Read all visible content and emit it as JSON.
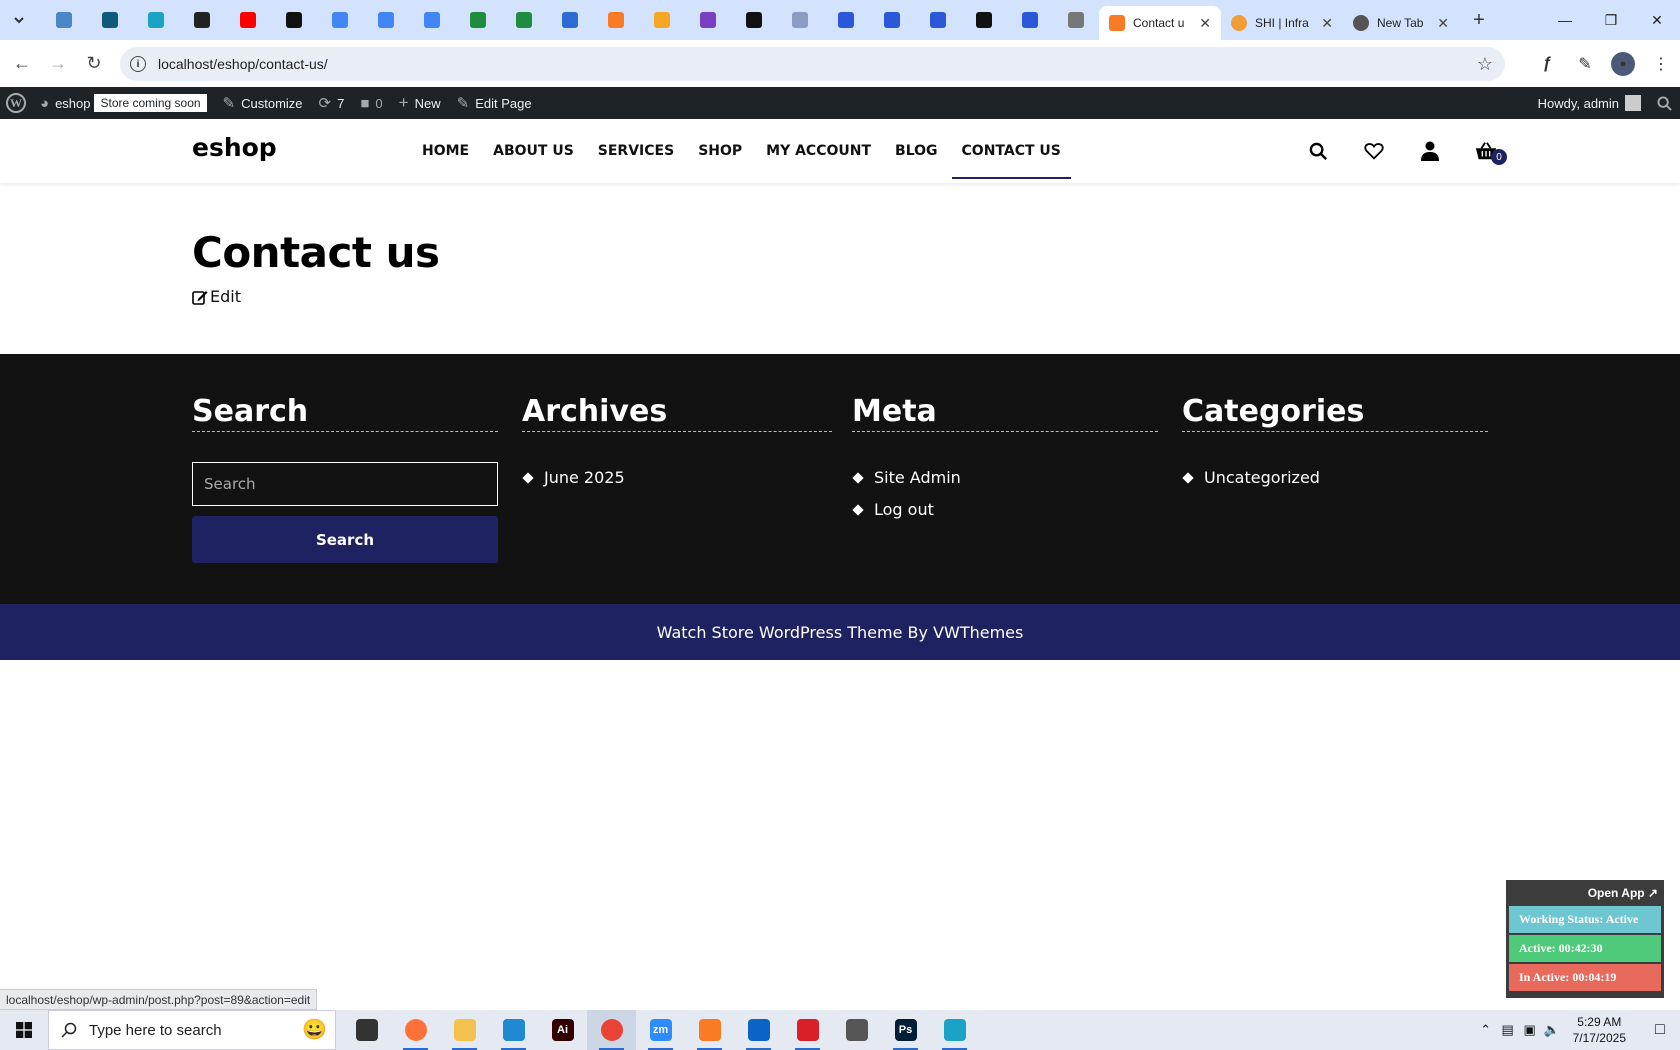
{
  "browser": {
    "pinned_tabs": [
      {
        "icon": "globe-half-icon",
        "color": "#4a86c8"
      },
      {
        "icon": "vue-icon",
        "color": "#0f5a7a"
      },
      {
        "icon": "diamond-logo-icon",
        "color": "#1aa3c7"
      },
      {
        "icon": "chatgpt-icon",
        "color": "#222222"
      },
      {
        "icon": "youtube-icon",
        "color": "#ff0000"
      },
      {
        "icon": "bolt-icon",
        "color": "#111111"
      },
      {
        "icon": "docs-icon",
        "color": "#4285f4"
      },
      {
        "icon": "docs-icon",
        "color": "#4285f4"
      },
      {
        "icon": "docs-icon",
        "color": "#4285f4"
      },
      {
        "icon": "sheets-icon",
        "color": "#1e8e3e"
      },
      {
        "icon": "sheets-icon",
        "color": "#1e8e3e"
      },
      {
        "icon": "word-icon",
        "color": "#2b6cd4"
      },
      {
        "icon": "xampp-icon",
        "color": "#fb7a24"
      },
      {
        "icon": "chevron-v-icon",
        "color": "#f5a623"
      },
      {
        "icon": "json-icon",
        "color": "#7b3fc4"
      },
      {
        "icon": "lambda-icon",
        "color": "#111111"
      },
      {
        "icon": "grid-icon",
        "color": "#8a9bc4"
      },
      {
        "icon": "forms-icon",
        "color": "#2b58d8"
      },
      {
        "icon": "forms-icon",
        "color": "#2b58d8"
      },
      {
        "icon": "forms-icon",
        "color": "#2b58d8"
      },
      {
        "icon": "medium-icon",
        "color": "#111111"
      },
      {
        "icon": "forms-icon",
        "color": "#2b58d8"
      },
      {
        "icon": "globe-icon",
        "color": "#777777"
      }
    ],
    "tabs": [
      {
        "label": "Contact u",
        "icon": "xampp-icon",
        "color": "#fb7a24",
        "active": true
      },
      {
        "label": "SHI | Infra",
        "icon": "circle-icon",
        "color": "#f29d38",
        "active": false
      },
      {
        "label": "New Tab",
        "icon": "chrome-icon",
        "color": "#555555",
        "active": false
      }
    ],
    "url": "localhost/eshop/contact-us/"
  },
  "adminbar": {
    "site_name": "eshop",
    "store_badge": "Store coming soon",
    "customize": "Customize",
    "updates_count": "7",
    "comments_count": "0",
    "new_label": "New",
    "edit_page": "Edit Page",
    "howdy": "Howdy, admin"
  },
  "site": {
    "logo": "eshop",
    "nav": [
      "HOME",
      "ABOUT US",
      "SERVICES",
      "SHOP",
      "MY ACCOUNT",
      "BLOG",
      "CONTACT US"
    ],
    "current_nav": "CONTACT US",
    "cart_count": "0"
  },
  "page": {
    "title": "Contact us",
    "edit_label": "Edit"
  },
  "footer": {
    "search": {
      "title": "Search",
      "placeholder": "Search",
      "button": "Search"
    },
    "archives": {
      "title": "Archives",
      "items": [
        "June 2025"
      ]
    },
    "meta": {
      "title": "Meta",
      "items": [
        "Site Admin",
        "Log out"
      ]
    },
    "categories": {
      "title": "Categories",
      "items": [
        "Uncategorized"
      ]
    },
    "copyright": "Watch Store WordPress Theme By VWThemes"
  },
  "status_link": "localhost/eshop/wp-admin/post.php?post=89&action=edit",
  "tracker": {
    "open_app": "Open App ↗",
    "working_status": "Working Status: Active",
    "active": "Active: 00:42:30",
    "inactive": "In Active: 00:04:19",
    "colors": {
      "status": "#6ec6d0",
      "active": "#4fc97a",
      "inactive": "#e86a5c"
    }
  },
  "taskbar": {
    "search_placeholder": "Type here to search",
    "apps": [
      {
        "icon": "task-view-icon",
        "label": "",
        "color": "#333333"
      },
      {
        "icon": "firefox-icon",
        "label": "",
        "color": "#ff7139"
      },
      {
        "icon": "file-explorer-icon",
        "label": "",
        "color": "#f2c14e"
      },
      {
        "icon": "vscode-icon",
        "label": "",
        "color": "#1f8ad2"
      },
      {
        "icon": "illustrator-icon",
        "label": "Ai",
        "color": "#330000"
      },
      {
        "icon": "chrome-icon",
        "label": "",
        "color": "#e94335"
      },
      {
        "icon": "zoom-icon",
        "label": "zm",
        "color": "#2d8cff"
      },
      {
        "icon": "xampp-icon",
        "label": "",
        "color": "#fb7a24"
      },
      {
        "icon": "outlook-icon",
        "label": "",
        "color": "#0a64c8"
      },
      {
        "icon": "creative-cloud-icon",
        "label": "",
        "color": "#da1f26"
      },
      {
        "icon": "pen-tool-icon",
        "label": "",
        "color": "#555555"
      },
      {
        "icon": "photoshop-icon",
        "label": "Ps",
        "color": "#001e36"
      },
      {
        "icon": "gem-app-icon",
        "label": "",
        "color": "#1aa3c7"
      }
    ],
    "time": "5:29 AM",
    "date": "7/17/2025"
  }
}
